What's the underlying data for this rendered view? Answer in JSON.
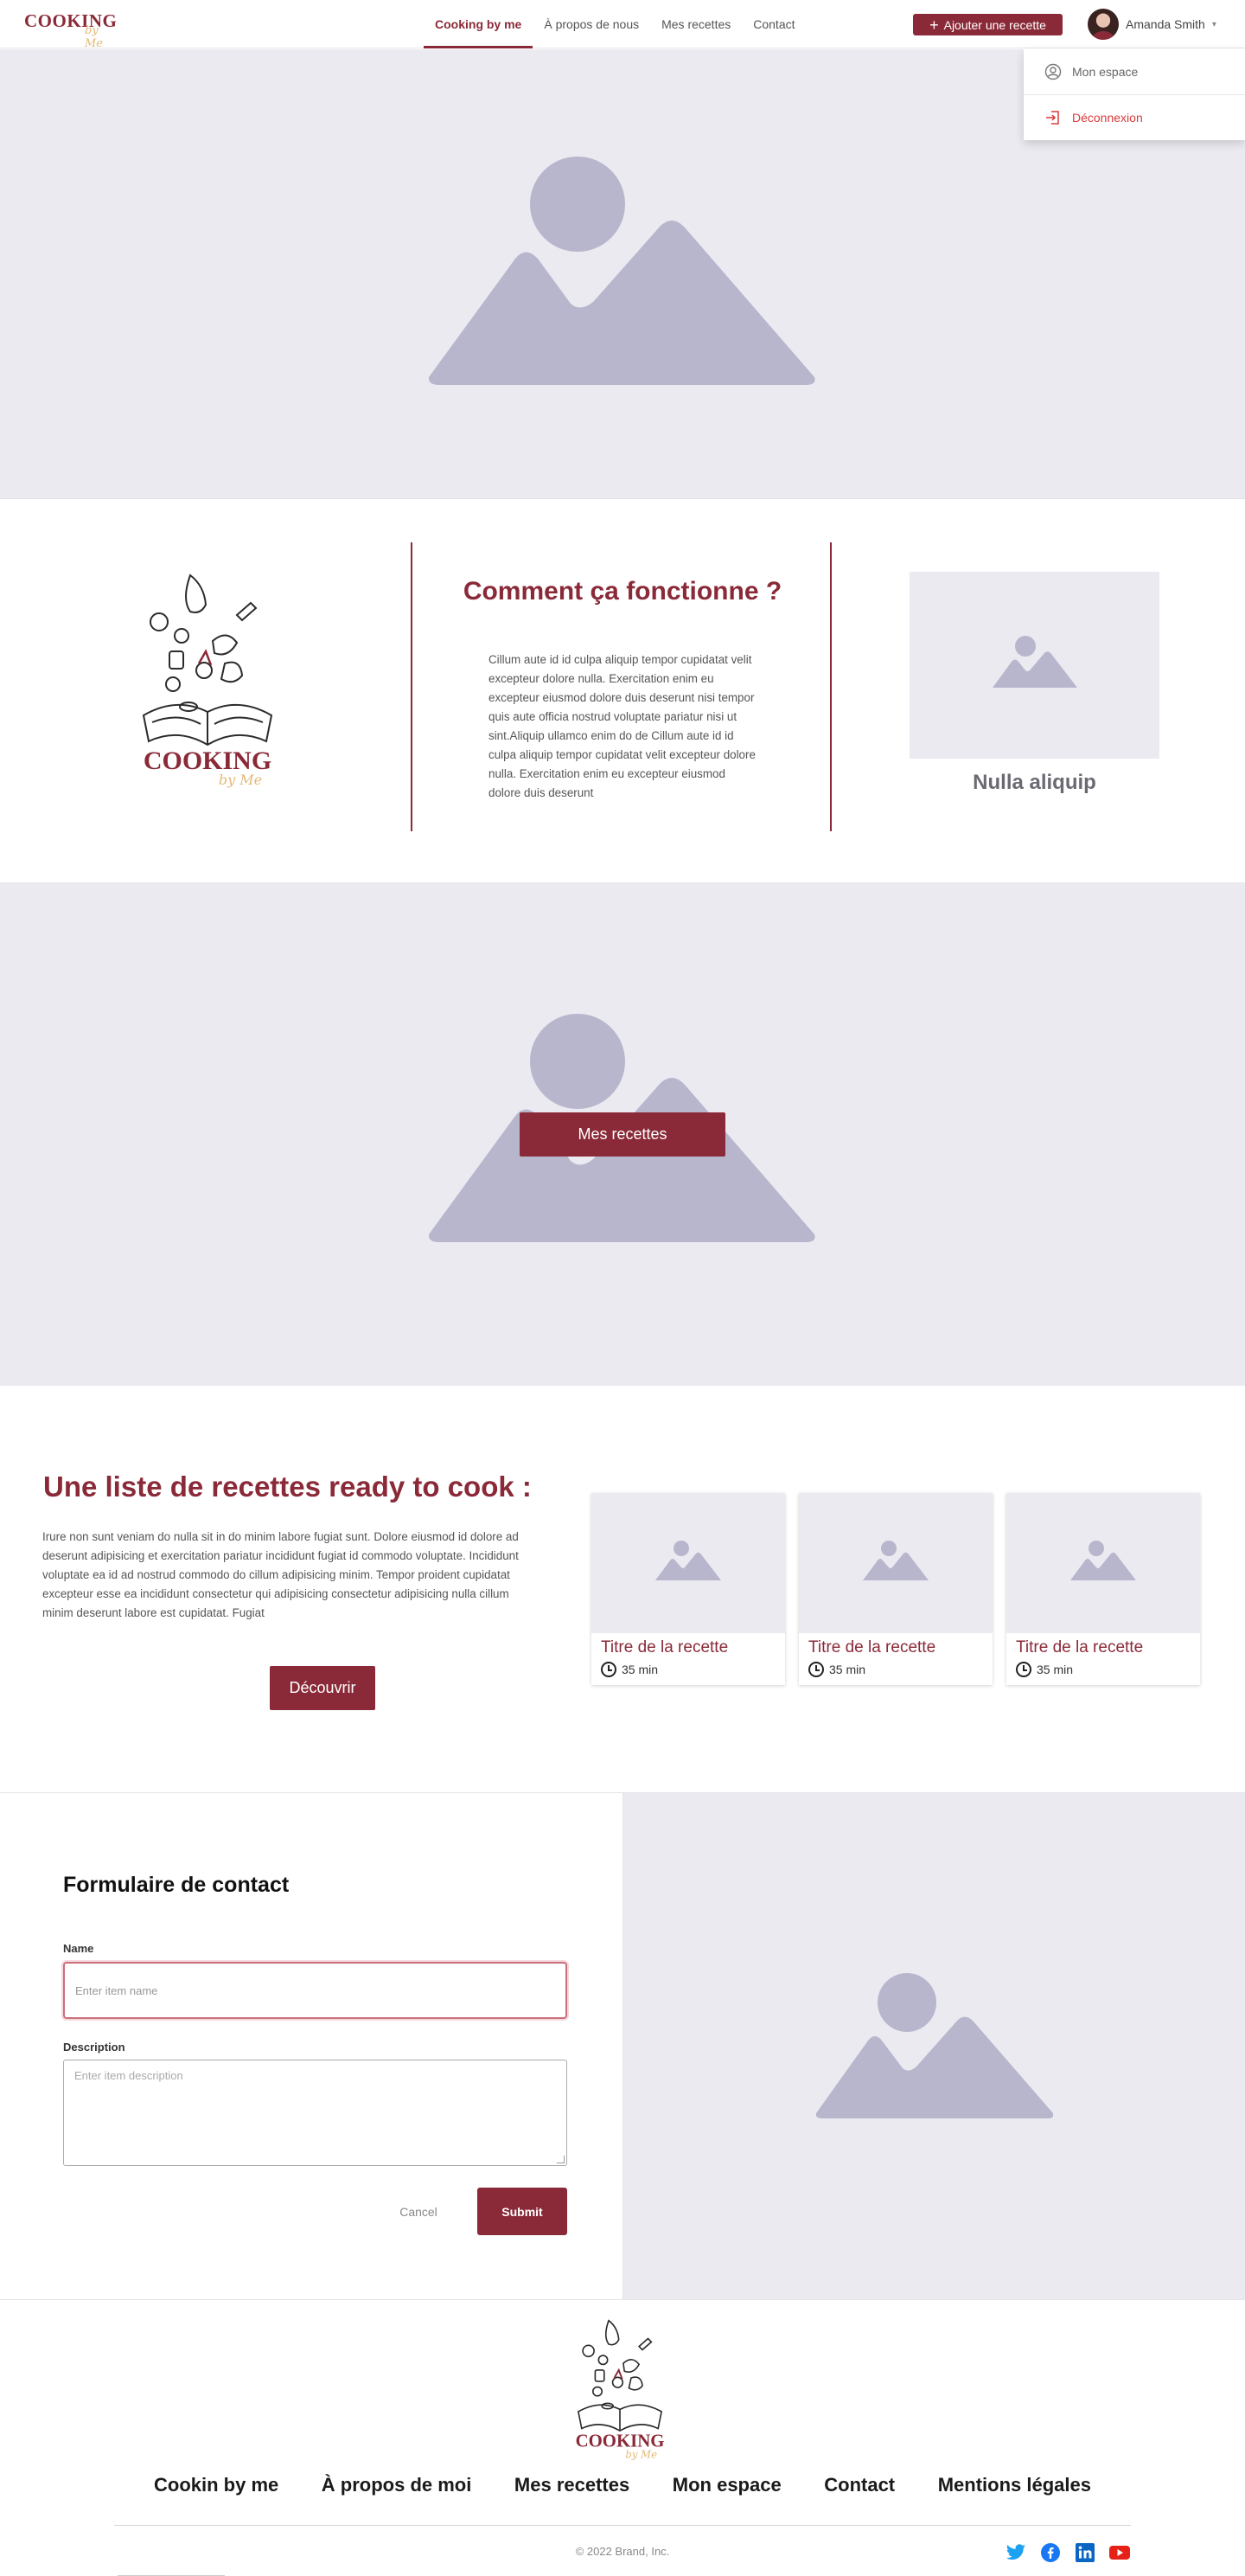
{
  "brand": {
    "logo_word": "COOKING",
    "logo_script": "by Me"
  },
  "nav": {
    "links": [
      {
        "label": "Cooking by me",
        "active": true
      },
      {
        "label": "À propos de nous",
        "active": false
      },
      {
        "label": "Mes recettes",
        "active": false
      },
      {
        "label": "Contact",
        "active": false
      }
    ],
    "add_recipe_label": "Ajouter une recette",
    "user_name": "Amanda Smith"
  },
  "user_menu": {
    "items": [
      {
        "label": "Mon espace",
        "icon": "user-circle-icon"
      },
      {
        "label": "Déconnexion",
        "icon": "logout-icon"
      }
    ]
  },
  "how": {
    "title": "Comment ça fonctionne ?",
    "text": "Cillum aute id id culpa aliquip tempor cupidatat velit excepteur dolore nulla. Exercitation enim eu excepteur eiusmod dolore duis deserunt nisi tempor quis aute officia nostrud voluptate pariatur nisi ut sint.Aliquip ullamco enim do de Cillum aute id id culpa aliquip tempor cupidatat velit excepteur dolore nulla. Exercitation enim eu excepteur eiusmod dolore duis deserunt",
    "caption": "Nulla aliquip"
  },
  "banner": {
    "button_label": "Mes recettes"
  },
  "list": {
    "title": "Une liste de recettes ready to cook :",
    "text": "Irure non sunt veniam do nulla sit in do minim labore fugiat sunt. Dolore eiusmod id dolore ad deserunt adipisicing et exercitation pariatur incididunt fugiat id commodo voluptate. Incididunt voluptate ea id ad nostrud commodo do cillum adipisicing minim. Tempor proident cupidatat excepteur esse ea incididunt consectetur qui adipisicing consectetur adipisicing nulla cillum minim deserunt labore est cupidatat. Fugiat",
    "button_label": "Découvrir",
    "cards": [
      {
        "title": "Titre de la recette",
        "time": "35 min"
      },
      {
        "title": "Titre de la recette",
        "time": "35 min"
      },
      {
        "title": "Titre de la recette",
        "time": "35 min"
      }
    ]
  },
  "contact": {
    "title": "Formulaire de contact",
    "name_label": "Name",
    "name_placeholder": "Enter item name",
    "description_label": "Description",
    "description_placeholder": "Enter item description",
    "cancel_label": "Cancel",
    "submit_label": "Submit"
  },
  "footer": {
    "links": [
      "Cookin by me",
      "À propos de moi",
      "Mes recettes",
      "Mon espace",
      "Contact",
      "Mentions légales"
    ],
    "copyright": "© 2022 Brand, Inc.",
    "socials": [
      "twitter-icon",
      "facebook-icon",
      "linkedin-icon",
      "youtube-icon"
    ]
  },
  "colors": {
    "accent": "#8a2a38",
    "placeholder_bg": "#ebeaf0",
    "placeholder_shape": "#b8b6cd"
  }
}
